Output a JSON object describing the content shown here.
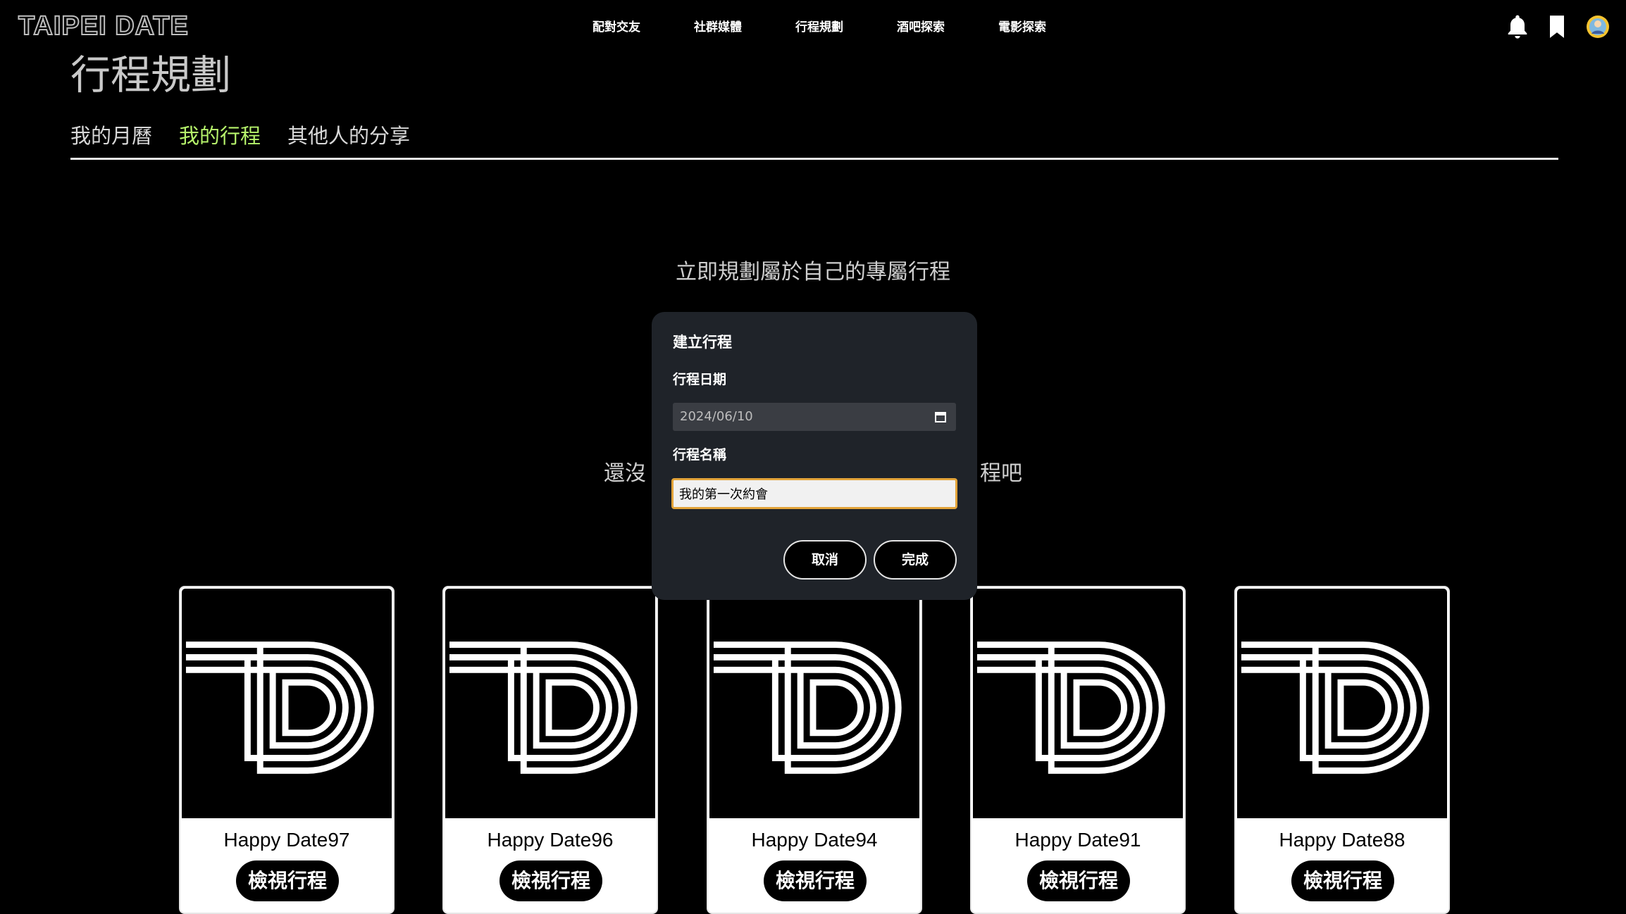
{
  "header": {
    "logo": "TAIPEI DATE",
    "nav": [
      {
        "label": "配對交友"
      },
      {
        "label": "社群媒體"
      },
      {
        "label": "行程規劃"
      },
      {
        "label": "酒吧探索"
      },
      {
        "label": "電影探索"
      }
    ],
    "icons": [
      "bell-icon",
      "bookmark-icon",
      "avatar"
    ]
  },
  "page": {
    "title": "行程規劃",
    "tabs": [
      {
        "label": "我的月曆",
        "active": false
      },
      {
        "label": "我的行程",
        "active": true
      },
      {
        "label": "其他人的分享",
        "active": false
      }
    ],
    "promo": "立即規劃屬於自己的專屬行程",
    "empty_partial_left": "還沒",
    "empty_partial_right": "程吧",
    "active_tab_color": "#b6f36b"
  },
  "cards": [
    {
      "title": "Happy Date97",
      "button": "檢視行程"
    },
    {
      "title": "Happy Date96",
      "button": "檢視行程"
    },
    {
      "title": "Happy Date94",
      "button": "檢視行程"
    },
    {
      "title": "Happy Date91",
      "button": "檢視行程"
    },
    {
      "title": "Happy Date88",
      "button": "檢視行程"
    }
  ],
  "modal": {
    "title": "建立行程",
    "date_label": "行程日期",
    "date_value": "2024/06/10",
    "name_label": "行程名稱",
    "name_value": "我的第一次約會",
    "cancel": "取消",
    "done": "完成",
    "focus_color": "#e3a43a"
  }
}
